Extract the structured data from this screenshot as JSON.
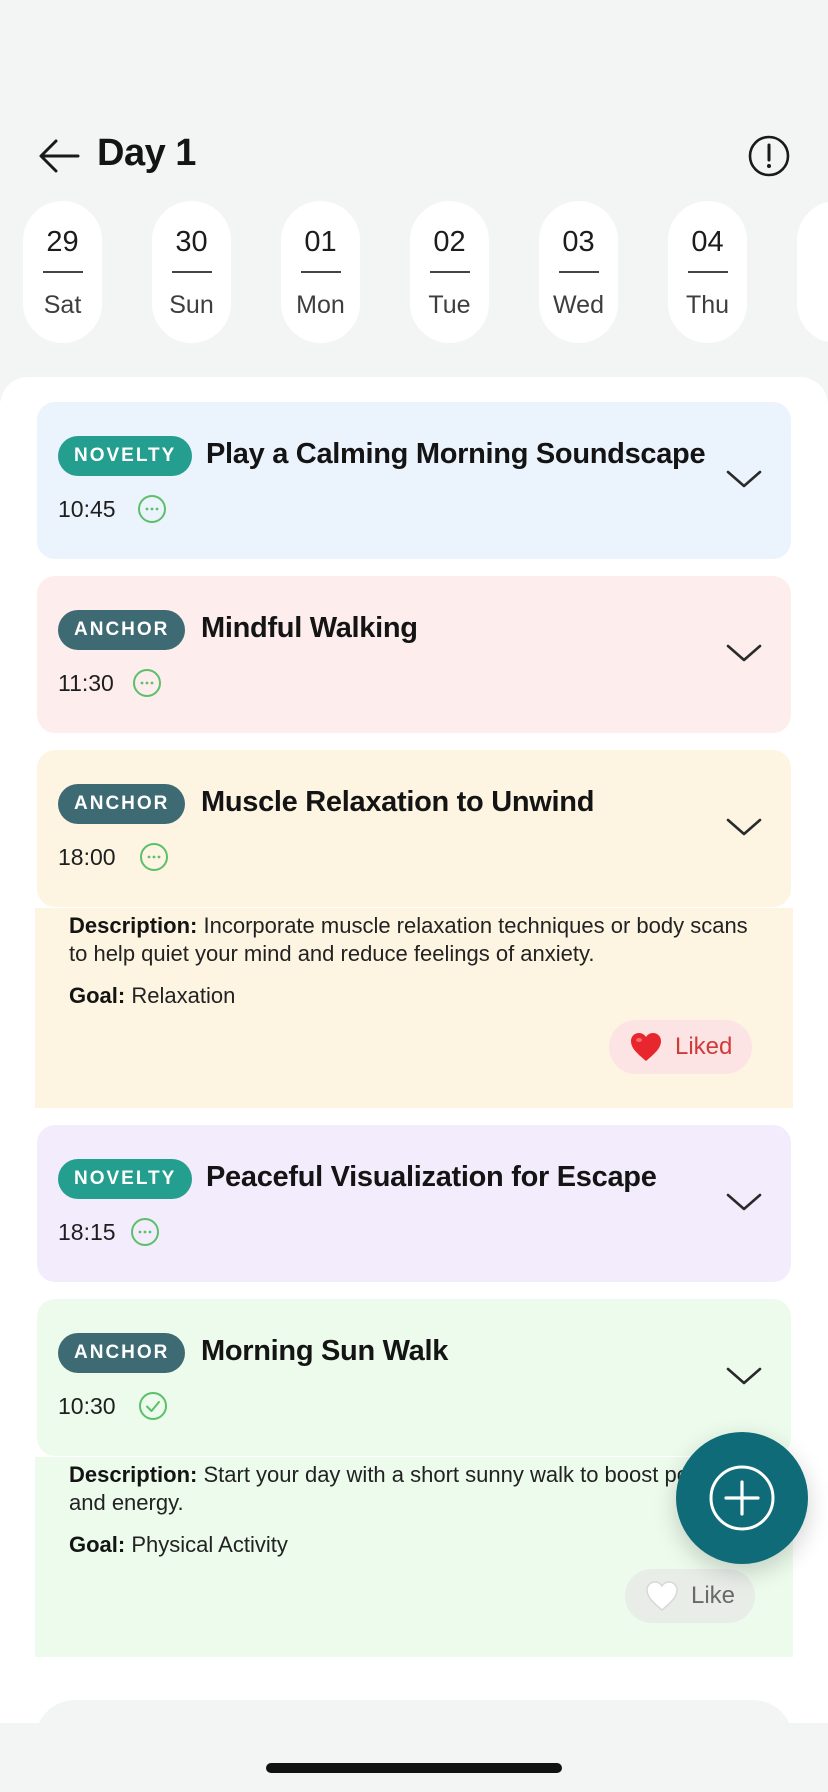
{
  "header": {
    "title": "Day 1",
    "back_icon": "arrow-left-icon",
    "info_icon": "exclamation-circle-icon"
  },
  "days": [
    {
      "num": "29",
      "name": "Sat"
    },
    {
      "num": "30",
      "name": "Sun"
    },
    {
      "num": "01",
      "name": "Mon"
    },
    {
      "num": "02",
      "name": "Tue"
    },
    {
      "num": "03",
      "name": "Wed"
    },
    {
      "num": "04",
      "name": "Thu"
    }
  ],
  "cards": [
    {
      "badge": "NOVELTY",
      "title": "Play a Calming Morning Soundscape",
      "time": "10:45",
      "status": "pending",
      "color": "#ebf3fd"
    },
    {
      "badge": "ANCHOR",
      "title": "Mindful Walking",
      "time": "11:30",
      "status": "pending",
      "color": "#fdeded"
    },
    {
      "badge": "ANCHOR",
      "title": "Muscle Relaxation to Unwind",
      "time": "18:00",
      "status": "pending",
      "color": "#fdf5e2",
      "description_label": "Description:",
      "description": "Incorporate muscle relaxation techniques or body scans to help quiet your mind and reduce feelings of anxiety.",
      "goal_label": "Goal:",
      "goal": "Relaxation",
      "like_label": "Liked",
      "liked": true
    },
    {
      "badge": "NOVELTY",
      "title": "Peaceful Visualization for Escape",
      "time": "18:15",
      "status": "pending",
      "color": "#f3ecfc"
    },
    {
      "badge": "ANCHOR",
      "title": "Morning Sun Walk",
      "time": "10:30",
      "status": "done",
      "color": "#ecfbec",
      "description_label": "Description:",
      "description": "Start your day with a short sunny walk to boost positivity and energy.",
      "goal_label": "Goal:",
      "goal": "Physical Activity",
      "like_label": "Like",
      "liked": false
    }
  ],
  "colors": {
    "novelty_badge": "#249e8f",
    "anchor_badge": "#3d6a73",
    "fab": "#0f6b78",
    "status_green": "#5cbf6a",
    "liked_text": "#d23a3a"
  },
  "fab_icon": "plus-circle-icon"
}
